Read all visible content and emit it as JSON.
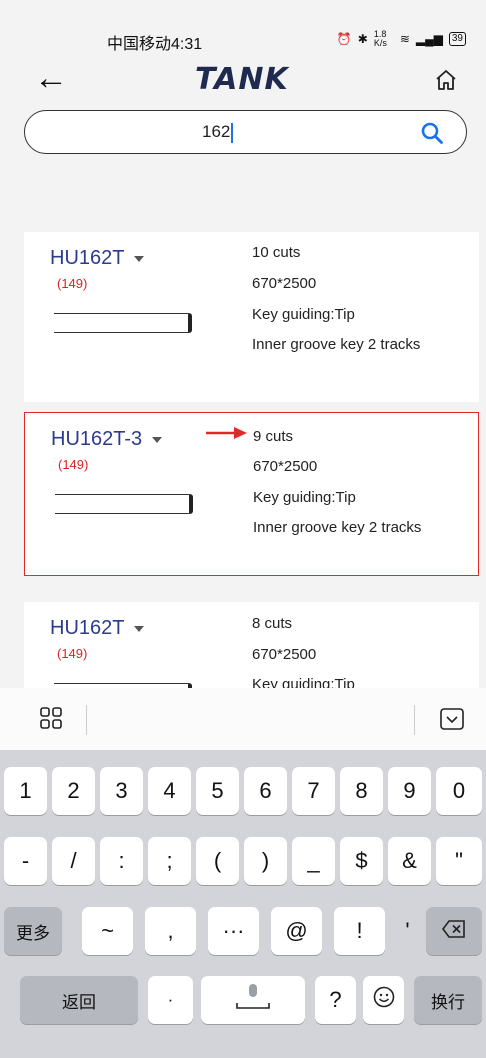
{
  "status": {
    "carrier": "中国移动",
    "time": "4:31",
    "net_speed": "1.8 K/s",
    "battery": "39"
  },
  "header": {
    "logo": "TANK"
  },
  "search": {
    "value": "162"
  },
  "results": [
    {
      "name": "HU162T",
      "count": "(149)",
      "cuts": "10 cuts",
      "size": "670*2500",
      "guiding": "Key guiding:Tip",
      "groove": "Inner groove key 2 tracks"
    },
    {
      "name": "HU162T-3",
      "count": "(149)",
      "cuts": "9 cuts",
      "size": "670*2500",
      "guiding": "Key guiding:Tip",
      "groove": "Inner groove key 2 tracks"
    },
    {
      "name": "HU162T",
      "count": "(149)",
      "cuts": "8 cuts",
      "size": "670*2500",
      "guiding": "Key guiding:Tip"
    }
  ],
  "keyboard": {
    "row1": [
      "1",
      "2",
      "3",
      "4",
      "5",
      "6",
      "7",
      "8",
      "9",
      "0"
    ],
    "row2": [
      "-",
      "/",
      ":",
      ";",
      "(",
      ")",
      "_",
      "$",
      "&",
      "\""
    ],
    "row3_more": "更多",
    "row3": [
      "~",
      ",",
      "···",
      "@",
      "!",
      "'"
    ],
    "row4_back": "返回",
    "row4_dot": "·",
    "row4_q": "?",
    "row4_enter": "换行"
  },
  "colors": {
    "brand_text": "#2d3b8c",
    "highlight_border": "#e02a2a",
    "search_accent": "#1a73e8"
  }
}
